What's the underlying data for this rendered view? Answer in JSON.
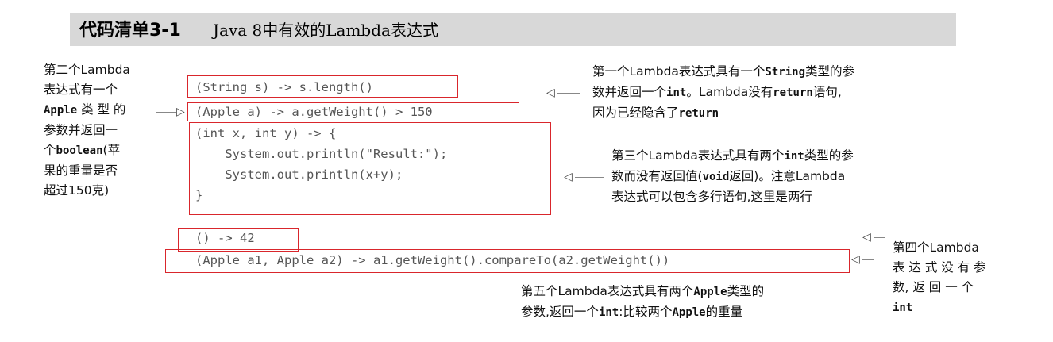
{
  "title": {
    "label": "代码清单3-1",
    "text": "Java 8中有效的Lambda表达式"
  },
  "code": {
    "line1": "(String s) -> s.length()",
    "line2": "(Apple a) -> a.getWeight() > 150",
    "line3": "(int x, int y) -> {",
    "line4": "    System.out.println(\"Result:\");",
    "line5": "    System.out.println(x+y);",
    "line6": "}",
    "line7": "() -> 42",
    "line8": "(Apple a1, Apple a2) -> a1.getWeight().compareTo(a2.getWeight())"
  },
  "annotations": {
    "left": {
      "l1": "第二个Lambda",
      "l2": "表达式有一个",
      "l3_code": "Apple",
      "l3_text": " 类 型 的",
      "l4": "参数并返回一",
      "l5_pre": "个",
      "l5_code": "boolean",
      "l5_post": "(苹",
      "l6": "果的重量是否",
      "l7": "超过150克)"
    },
    "first": {
      "l1": "第一个Lambda表达式具有一个",
      "l1_code": "String",
      "l1_post": "类型的参",
      "l2_pre": "数并返回一个",
      "l2_code": "int",
      "l2_mid": "。Lambda没有",
      "l2_code2": "return",
      "l2_post": "语句,",
      "l3_pre": "因为已经隐含了",
      "l3_code": "return"
    },
    "third": {
      "l1_pre": "第三个Lambda表达式具有两个",
      "l1_code": "int",
      "l1_post": "类型的参",
      "l2_pre": "数而没有返回值(",
      "l2_code": "void",
      "l2_post": "返回)。注意Lambda",
      "l3": "表达式可以包含多行语句,这里是两行"
    },
    "fourth": {
      "l1": "第四个Lambda",
      "l2": "表 达 式 没 有 参",
      "l3": "数, 返 回 一 个",
      "l4_code": "int"
    },
    "fifth": {
      "l1_pre": "第五个Lambda表达式具有两个",
      "l1_code": "Apple",
      "l1_post": "类型的",
      "l2_pre": "参数,返回一个",
      "l2_code": "int",
      "l2_mid": ":比较两个",
      "l2_code2": "Apple",
      "l2_post": "的重量"
    }
  },
  "colors": {
    "box": "#d9262c",
    "title_bg": "#d8d8d8",
    "code_text": "#555555"
  }
}
